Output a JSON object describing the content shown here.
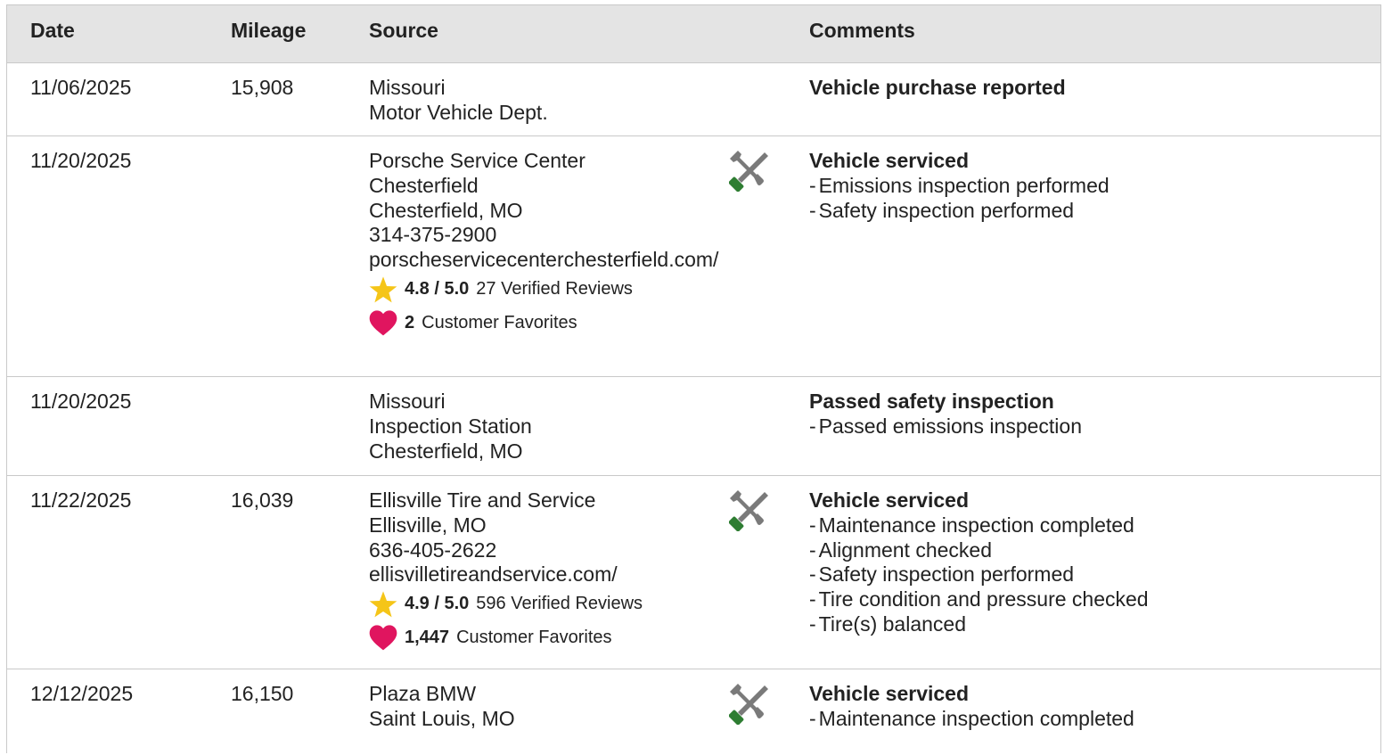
{
  "headers": {
    "date": "Date",
    "mileage": "Mileage",
    "source": "Source",
    "comments": "Comments"
  },
  "colors": {
    "header_bg": "#e4e4e4",
    "border": "#c9c9c9",
    "star": "#f5c518",
    "heart": "#e0155f",
    "wrench_gray": "#7a7a7a",
    "screwdriver_green": "#2e7d32"
  },
  "rows": [
    {
      "date": "11/06/2025",
      "mileage": "15,908",
      "source_lines": [
        "Missouri",
        "Motor Vehicle Dept."
      ],
      "comment_title": "Vehicle purchase reported",
      "comment_items": []
    },
    {
      "date": "11/20/2025",
      "mileage": "",
      "source_lines": [
        "Porsche Service Center",
        "Chesterfield",
        "Chesterfield, MO",
        "314-375-2900"
      ],
      "source_url": "porscheservicecenterchesterfield.com/",
      "rating": "4.8 / 5.0",
      "reviews": "27 Verified Reviews",
      "favorites_count": "2",
      "favorites_label": "Customer Favorites",
      "icon": "service-tools-icon",
      "comment_title": "Vehicle serviced",
      "comment_items": [
        "Emissions inspection performed",
        "Safety inspection performed"
      ]
    },
    {
      "date": "11/20/2025",
      "mileage": "",
      "source_lines": [
        "Missouri",
        "Inspection Station",
        "Chesterfield, MO"
      ],
      "comment_title": "Passed safety inspection",
      "comment_items": [
        "Passed emissions inspection"
      ]
    },
    {
      "date": "11/22/2025",
      "mileage": "16,039",
      "source_lines": [
        "Ellisville Tire and Service",
        "Ellisville, MO",
        "636-405-2622",
        "ellisvilletireandservice.com/"
      ],
      "rating": "4.9 / 5.0",
      "reviews": "596 Verified Reviews",
      "favorites_count": "1,447",
      "favorites_label": "Customer Favorites",
      "icon": "service-tools-icon",
      "comment_title": "Vehicle serviced",
      "comment_items": [
        "Maintenance inspection completed",
        "Alignment checked",
        "Safety inspection performed",
        "Tire condition and pressure checked",
        "Tire(s) balanced"
      ]
    },
    {
      "date": "12/12/2025",
      "mileage": "16,150",
      "source_lines": [
        "Plaza BMW",
        "Saint Louis, MO"
      ],
      "icon": "service-tools-icon",
      "comment_title": "Vehicle serviced",
      "comment_items": [
        "Maintenance inspection completed"
      ]
    }
  ],
  "dash": "-"
}
